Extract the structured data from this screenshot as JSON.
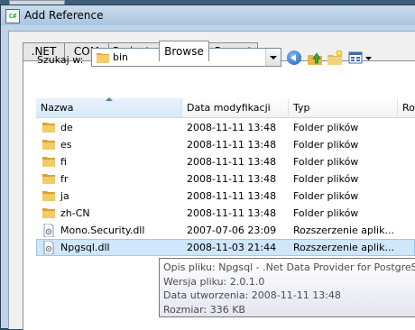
{
  "window": {
    "title": "Add Reference",
    "title_icon_text": "C#"
  },
  "tabs": [
    {
      "label": ".NET"
    },
    {
      "label": "COM"
    },
    {
      "label": "Projects"
    },
    {
      "label": "Browse"
    },
    {
      "label": "Recent"
    }
  ],
  "active_tab": "Browse",
  "lookin": {
    "label": "Szukaj w:",
    "value": "bin"
  },
  "toolbar": {
    "back_icon": "back-arrow-icon",
    "up_icon": "up-folder-icon",
    "new_folder_icon": "new-folder-icon",
    "views_icon": "views-menu-icon"
  },
  "columns": {
    "name": "Nazwa",
    "date": "Data modyfikacji",
    "type": "Typ",
    "size": "Ro"
  },
  "rows": [
    {
      "name": "de",
      "date": "2008-11-11 13:48",
      "type": "Folder plików",
      "icon": "folder-icon"
    },
    {
      "name": "es",
      "date": "2008-11-11 13:48",
      "type": "Folder plików",
      "icon": "folder-icon"
    },
    {
      "name": "fi",
      "date": "2008-11-11 13:48",
      "type": "Folder plików",
      "icon": "folder-icon"
    },
    {
      "name": "fr",
      "date": "2008-11-11 13:48",
      "type": "Folder plików",
      "icon": "folder-icon"
    },
    {
      "name": "ja",
      "date": "2008-11-11 13:48",
      "type": "Folder plików",
      "icon": "folder-icon"
    },
    {
      "name": "zh-CN",
      "date": "2008-11-11 13:48",
      "type": "Folder plików",
      "icon": "folder-icon"
    },
    {
      "name": "Mono.Security.dll",
      "date": "2007-07-06 23:09",
      "type": "Rozszerzenie aplik...",
      "icon": "dll-file-icon"
    },
    {
      "name": "Npgsql.dll",
      "date": "2008-11-03 21:44",
      "type": "Rozszerzenie aplik...",
      "icon": "dll-file-icon"
    }
  ],
  "selected_row": "Npgsql.dll",
  "tooltip": {
    "line1": "Opis pliku: Npgsql - .Net Data Provider for PostgreSQL",
    "line2": "Wersja pliku: 2.0.1.0",
    "line3": "Data utworzenia: 2008-11-11 13:48",
    "line4": "Rozmiar: 336 KB"
  },
  "colors": {
    "selection": "#cfe6fb",
    "selection_border": "#99c9ef",
    "folder": "#e8b84a"
  }
}
